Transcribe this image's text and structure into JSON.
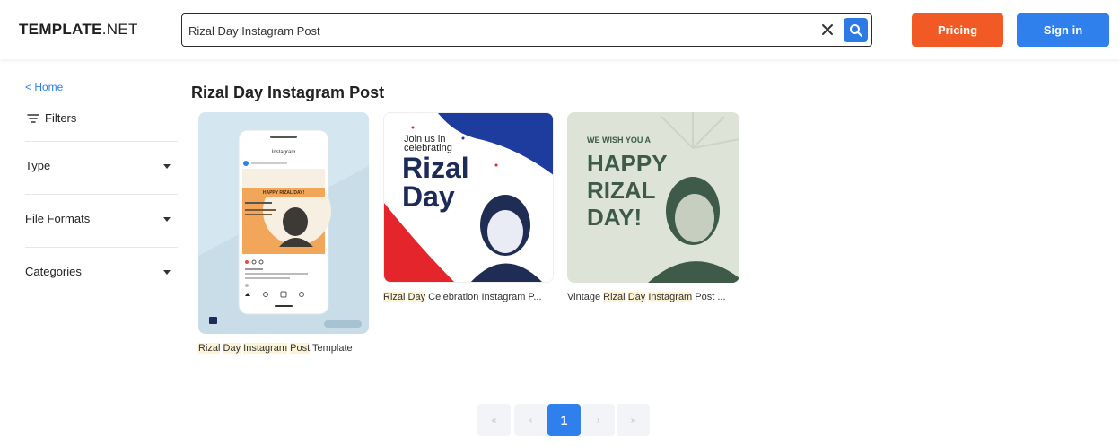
{
  "header": {
    "logo_bold": "TEMPLATE",
    "logo_light": ".NET",
    "search": {
      "value": "Rizal Day Instagram Post",
      "placeholder": "Search"
    },
    "pricing_label": "Pricing",
    "signin_label": "Sign in"
  },
  "sidebar": {
    "home_label": "< Home",
    "filters_label": "Filters",
    "sections": [
      {
        "label": "Type"
      },
      {
        "label": "File Formats"
      },
      {
        "label": "Categories"
      }
    ]
  },
  "main": {
    "title": "Rizal Day Instagram Post",
    "cards": [
      {
        "caption_parts": [
          "Rizal",
          "Day",
          "Instagram",
          "Post"
        ],
        "caption_rest": "Template",
        "mock": {
          "app_title": "Instagram",
          "post_text": "HAPPY RIZAL DAY!"
        }
      },
      {
        "caption_parts": [
          "Rizal",
          "Day"
        ],
        "caption_rest": "Celebration Instagram P...",
        "art": {
          "line1": "Join us in",
          "line2": "celebrating",
          "big1": "Rizal",
          "big2": "Day"
        }
      },
      {
        "caption_parts": [
          "Rizal",
          "Day",
          "Instagram",
          "Post"
        ],
        "caption_prefix": "Vintage",
        "caption_rest": "...",
        "art": {
          "small": "WE WISH YOU A",
          "big1": "HAPPY",
          "big2": "RIZAL",
          "big3": "DAY!"
        }
      }
    ]
  },
  "pagination": {
    "first": "«",
    "prev": "‹",
    "current": "1",
    "next": "›",
    "last": "»"
  },
  "colors": {
    "accent_blue": "#2f80ed",
    "pricing_orange": "#f15a24",
    "caption_highlight": "#fdf3d6"
  }
}
